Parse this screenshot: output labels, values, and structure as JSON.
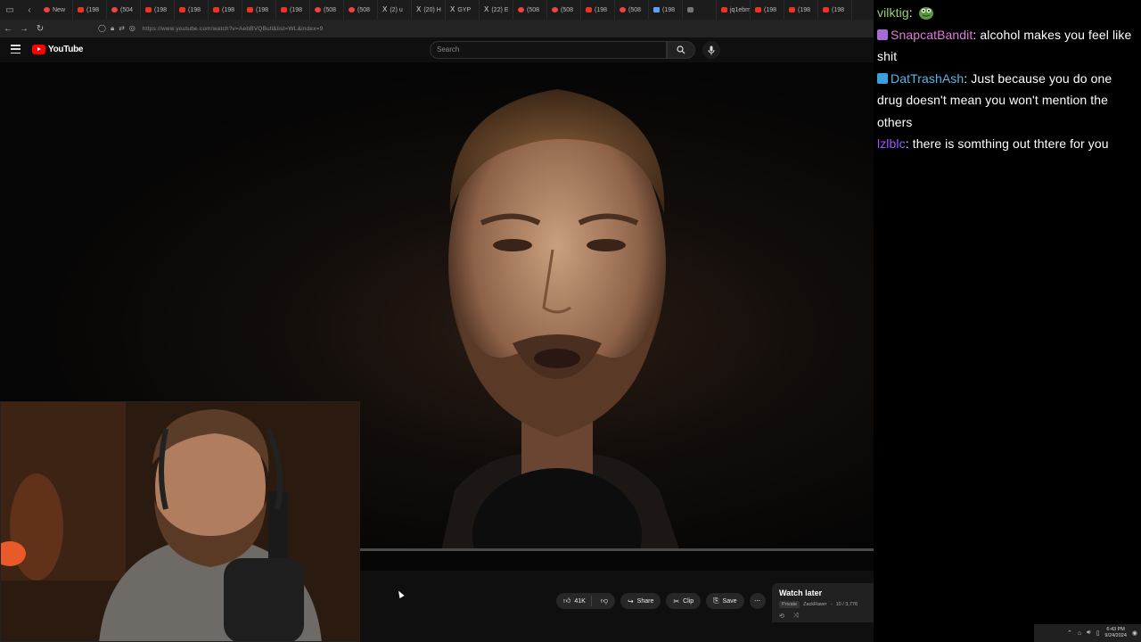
{
  "browser": {
    "tabs": [
      {
        "label": "New",
        "fav": "r"
      },
      {
        "label": "(198",
        "fav": ""
      },
      {
        "label": "(504",
        "fav": "r"
      },
      {
        "label": "(198",
        "fav": ""
      },
      {
        "label": "(198",
        "fav": ""
      },
      {
        "label": "(198",
        "fav": ""
      },
      {
        "label": "(198",
        "fav": ""
      },
      {
        "label": "(198",
        "fav": ""
      },
      {
        "label": "(508",
        "fav": "r"
      },
      {
        "label": "(508",
        "fav": "r"
      },
      {
        "label": "(2) u",
        "fav": "x"
      },
      {
        "label": "(20) H",
        "fav": "x"
      },
      {
        "label": "GYP",
        "fav": "x"
      },
      {
        "label": "(22) E",
        "fav": "x"
      },
      {
        "label": "(508",
        "fav": "r"
      },
      {
        "label": "(508",
        "fav": "r"
      },
      {
        "label": "(198",
        "fav": ""
      },
      {
        "label": "(508",
        "fav": "r"
      },
      {
        "label": "(198",
        "fav": "b"
      },
      {
        "label": "",
        "fav": "s"
      },
      {
        "label": "jq1ebmwi",
        "fav": ""
      },
      {
        "label": "(198",
        "fav": ""
      },
      {
        "label": "(198",
        "fav": ""
      },
      {
        "label": "(198",
        "fav": ""
      }
    ],
    "url": "https://www.youtube.com/watch?v=AebBVQBull&list=WL&index=9"
  },
  "youtube": {
    "brand": "YouTube",
    "search_placeholder": "Search"
  },
  "video": {
    "progress_fraction": 0.0
  },
  "chat": [
    {
      "user": "vilktig",
      "text": "",
      "color": "#9ad26a",
      "badge": "",
      "emote": true
    },
    {
      "user": "SnapcatBandit",
      "text": "alcohol makes you feel like shit",
      "color": "#e07bd6",
      "badge": "#a66bd6"
    },
    {
      "user": "DatTrashAsh",
      "text": "Just because you do one drug doesn't mean you won't mention the others",
      "color": "#5cb6e8",
      "badge": "#3aa0e0"
    },
    {
      "user": "lzlblc",
      "text": "there is somthing out thtere for you",
      "color": "#9b59ff",
      "badge": ""
    }
  ],
  "actions": {
    "likes": "41K",
    "share": "Share",
    "clip": "Clip",
    "save": "Save"
  },
  "watch_later": {
    "title": "Watch later",
    "privacy": "Private",
    "owner": "ZackRawrr",
    "position": "10 / 3,776"
  },
  "taskbar": {
    "time": "6:43 PM",
    "date": "9/24/2024"
  }
}
